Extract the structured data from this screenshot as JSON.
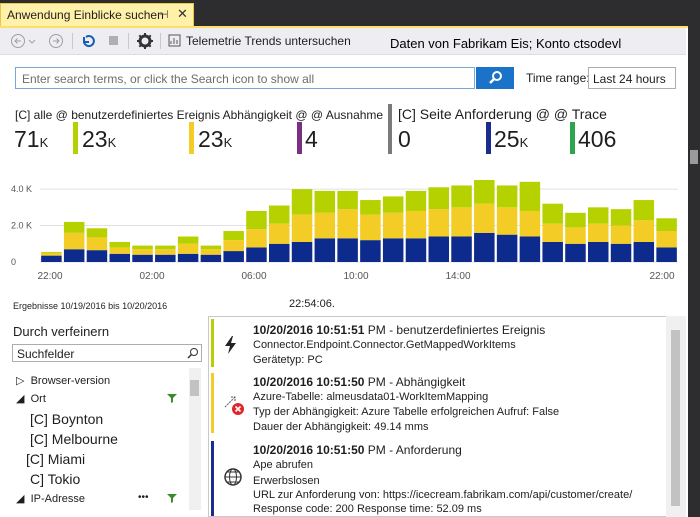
{
  "tab": {
    "title": "Anwendung Einblicke suchen",
    "pin": "⊣",
    "close": "✕"
  },
  "toolbar": {
    "back_icon": "back-icon",
    "forward_icon": "forward-icon",
    "refresh_icon": "refresh-icon",
    "stop_icon": "stop-icon",
    "settings_icon": "gear-icon",
    "trends_label": "Telemetrie Trends untersuchen",
    "account_text": "Daten von Fabrikam Eis; Konto ctsodevl"
  },
  "search": {
    "placeholder": "Enter search terms, or click the Search icon to show all",
    "time_range_label": "Time range:",
    "time_range_value": "Last 24 hours"
  },
  "metrics": {
    "group1_header": "[C] alle @ benutzerdefiniertes Ereignis Abhängigkeit @ @ Ausnahme",
    "group2_header": "[C] Seite Anforderung @ @ Trace",
    "items": [
      {
        "value": "71",
        "unit": "K",
        "color": "#ffffff"
      },
      {
        "value": "23",
        "unit": "K",
        "color": "#b6d100"
      },
      {
        "value": "23",
        "unit": "K",
        "color": "#f4cc26"
      },
      {
        "value": "4",
        "unit": "",
        "color": "#7b2f80"
      },
      {
        "value": "0",
        "unit": "",
        "color": "#7a7a7a"
      },
      {
        "value": "25",
        "unit": "K",
        "color": "#1a2c8c"
      },
      {
        "value": "406",
        "unit": "",
        "color": "#2ea44f"
      }
    ]
  },
  "chart_data": {
    "type": "bar",
    "stacked": true,
    "ylim": [
      0,
      4500
    ],
    "yticks": [
      "4.0 K",
      "2.0 K",
      "0"
    ],
    "xticks": [
      "22:00",
      "02:00",
      "06:00",
      "10:00",
      "14:00",
      "22:00"
    ],
    "colors": {
      "blue": "#0d2b8c",
      "yellow": "#f4cc26",
      "green": "#b6d100"
    },
    "series": [
      {
        "name": "blue",
        "values": [
          350,
          700,
          650,
          450,
          400,
          400,
          450,
          400,
          600,
          800,
          1000,
          1100,
          1300,
          1300,
          1200,
          1300,
          1300,
          1400,
          1400,
          1600,
          1500,
          1400,
          1100,
          1000,
          1100,
          1000,
          1100,
          800
        ]
      },
      {
        "name": "yellow",
        "values": [
          150,
          900,
          700,
          350,
          300,
          300,
          550,
          300,
          600,
          1000,
          1100,
          1500,
          1400,
          1600,
          1400,
          1400,
          1500,
          1500,
          1600,
          1600,
          1500,
          1400,
          1000,
          900,
          1000,
          1000,
          1200,
          900
        ]
      },
      {
        "name": "green",
        "values": [
          50,
          600,
          500,
          300,
          200,
          200,
          400,
          200,
          500,
          1000,
          1000,
          1400,
          1200,
          1000,
          800,
          900,
          1100,
          1200,
          1200,
          1600,
          1200,
          1600,
          1100,
          800,
          900,
          900,
          1100,
          700
        ]
      }
    ]
  },
  "range_text": "Ergebnisse 10/19/2016 bis 10/20/2016",
  "clock_text": "22:54:06.",
  "refine": {
    "title": "Durch verfeinern",
    "search_label": "Suchfelder",
    "tree": [
      {
        "arrow": "▷",
        "label": "Browser-version"
      },
      {
        "arrow": "◢",
        "label": "Ort"
      },
      {
        "label": "[C] Boynton"
      },
      {
        "label": "[C] Melbourne"
      },
      {
        "label": "[C] Miami"
      },
      {
        "label": "C] Tokio"
      },
      {
        "arrow": "◢",
        "label": "IP-Adresse",
        "dots": "•••"
      }
    ]
  },
  "results": [
    {
      "stripe": "#b6d100",
      "icon": "lightning-icon",
      "glyph": "⚡",
      "timestamp": "10/20/2016 10:51:51",
      "kind": " PM - benutzerdefiniertes Ereignis",
      "lines": [
        "Connector.Endpoint.Connector.GetMappedWorkItems",
        "Gerätetyp: PC"
      ]
    },
    {
      "stripe": "#f4cc26",
      "icon": "dependency-error-icon",
      "glyph": "⤤",
      "timestamp": "10/20/2016 10:51:50",
      "kind": " PM - Abhängigkeit",
      "lines": [
        "Azure-Tabelle: almeusdata01-WorkItemMapping",
        "Typ der Abhängigkeit: Azure Tabelle erfolgreichen Aufruf: False",
        "Dauer der Abhängigkeit: 49.14 mms"
      ]
    },
    {
      "stripe": "#1a2c8c",
      "icon": "globe-icon",
      "glyph": "⊕",
      "timestamp": "10/20/2016 10:51:50",
      "kind": " PM - Anforderung",
      "lines": [
        "Ape abrufen",
        "Erwerbslosen",
        "URL zur Anforderung von: https://icecream.fabrikam.com/api/customer/create/",
        "Response code: 200 Response time: 52.09 ms"
      ]
    }
  ]
}
